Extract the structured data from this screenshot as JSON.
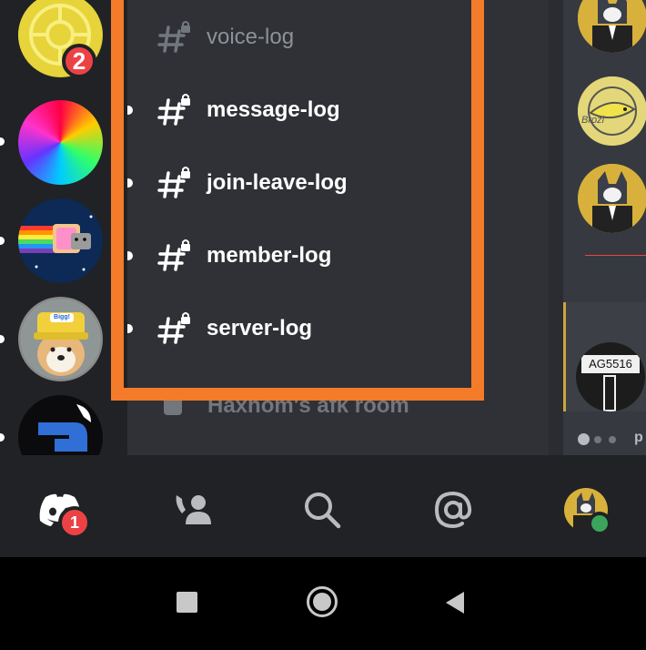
{
  "servers": [
    {
      "name": "yellow-emblem-server",
      "badge": "2"
    },
    {
      "name": "rainbow-gradient-server"
    },
    {
      "name": "nyan-cat-server"
    },
    {
      "name": "shiba-hat-server",
      "hat_text": "Bigg!"
    },
    {
      "name": "dark-logo-server"
    }
  ],
  "channels": [
    {
      "label": "voice-log",
      "state": "muted"
    },
    {
      "label": "message-log",
      "state": "unread"
    },
    {
      "label": "join-leave-log",
      "state": "unread"
    },
    {
      "label": "member-log",
      "state": "unread"
    },
    {
      "label": "server-log",
      "state": "unread"
    }
  ],
  "afk_channel": {
    "label": "Haxhom's afk room"
  },
  "right_panel": {
    "sign_text": "AG5516",
    "preview_text": "p",
    "avatar_caption": "Brozi"
  },
  "bottom_nav": {
    "home_badge": "1",
    "items": [
      "home",
      "friends",
      "search",
      "mentions",
      "profile"
    ]
  },
  "colors": {
    "highlight": "#f47b2a",
    "badge": "#ed4245",
    "status_online": "#3ba55c"
  }
}
